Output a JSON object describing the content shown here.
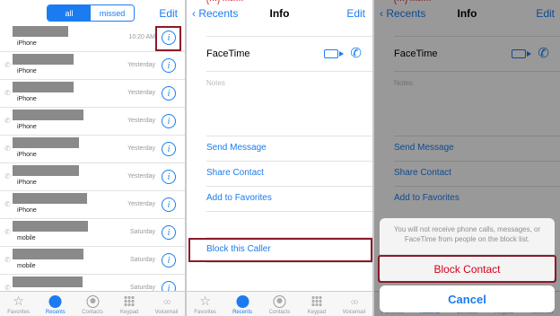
{
  "recents": {
    "filter_all": "all",
    "filter_missed": "missed",
    "edit": "Edit",
    "rows": [
      {
        "type": "iPhone",
        "time": "10:20 AM",
        "redact_w": 62
      },
      {
        "type": "iPhone",
        "time": "Yesterday",
        "redact_w": 68
      },
      {
        "type": "iPhone",
        "time": "Yesterday",
        "redact_w": 68
      },
      {
        "type": "iPhone",
        "time": "Yesterday",
        "redact_w": 79
      },
      {
        "type": "iPhone",
        "time": "Yesterday",
        "redact_w": 74
      },
      {
        "type": "iPhone",
        "time": "Yesterday",
        "redact_w": 74
      },
      {
        "type": "iPhone",
        "time": "Yesterday",
        "redact_w": 83
      },
      {
        "type": "mobile",
        "time": "Saturday",
        "redact_w": 84
      },
      {
        "type": "mobile",
        "time": "Saturday",
        "redact_w": 79
      },
      {
        "type": "",
        "time": "Saturday",
        "redact_w": 78
      }
    ]
  },
  "tabs": [
    "Favorites",
    "Recents",
    "Contacts",
    "Keypad",
    "Voicemail"
  ],
  "info": {
    "back": "Recents",
    "title": "Info",
    "edit": "Edit",
    "facetime": "FaceTime",
    "notes": "Notes",
    "send_message": "Send Message",
    "share_contact": "Share Contact",
    "add_favorites": "Add to Favorites",
    "block_caller": "Block this Caller"
  },
  "sheet": {
    "message": "You will not receive phone calls, messages, or FaceTime from people on the block list.",
    "block": "Block Contact",
    "cancel": "Cancel"
  },
  "colors": {
    "accent": "#1a7cf0",
    "danger": "#d0021b",
    "highlight": "#8b1a2a"
  }
}
